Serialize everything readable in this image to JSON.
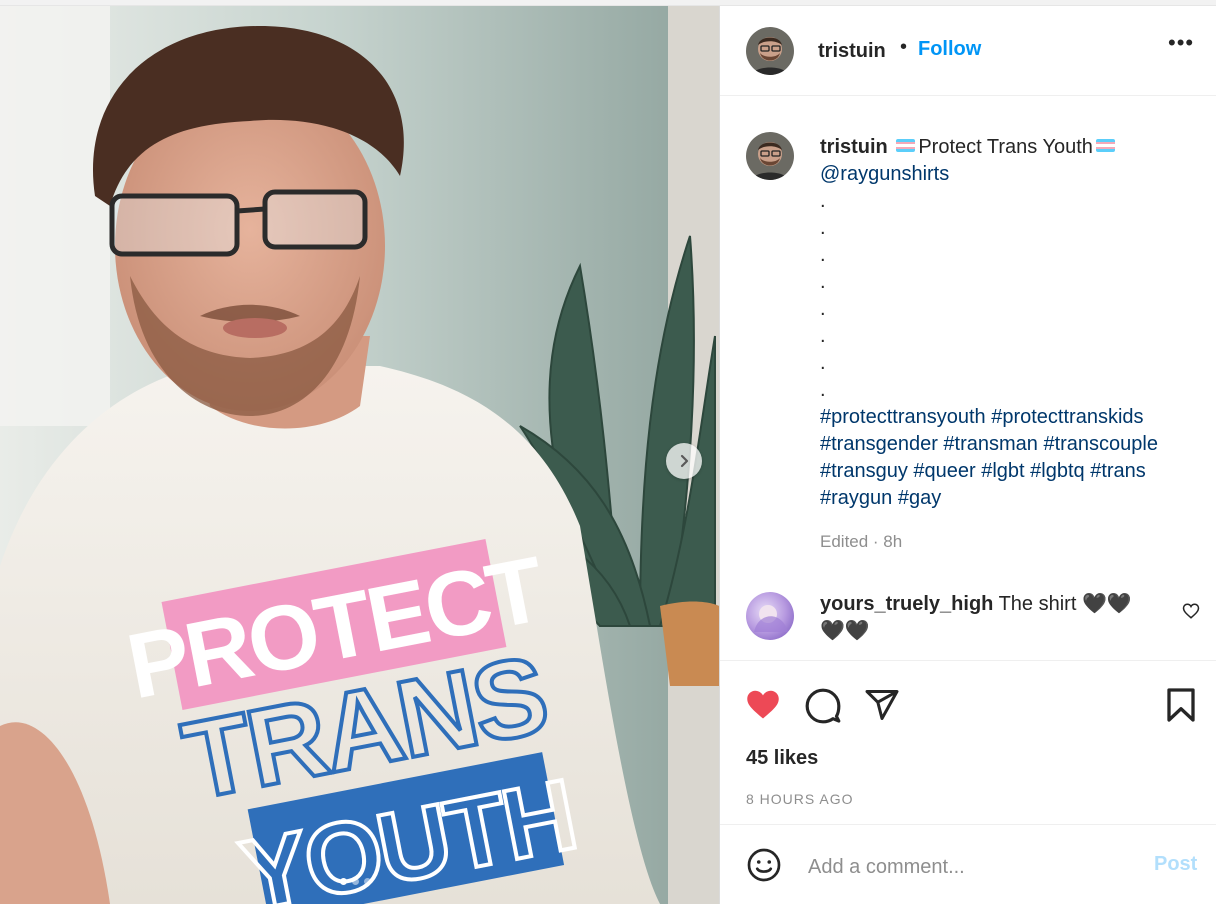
{
  "post": {
    "username": "tristuin",
    "follow_label": "Follow",
    "separator": "•",
    "more_label": "•••",
    "image_shirt_text": [
      "PROTECT",
      "TRANS",
      "YOUTH"
    ],
    "carousel_dots": 3,
    "carousel_active_index": 0
  },
  "caption": {
    "username": "tristuin",
    "text": "Protect Trans Youth",
    "mention": "@raygunshirts",
    "dots": [
      ".",
      ".",
      ".",
      ".",
      ".",
      ".",
      ".",
      "."
    ],
    "hashtags": "#protecttransyouth #protecttranskids #transgender #transman #transcouple #transguy #queer #lgbt #lgbtq #trans #raygun #gay",
    "edited": "Edited · 8h",
    "flag_colors": [
      "#5bcefa",
      "#f5a9b8",
      "#ffffff",
      "#f5a9b8",
      "#5bcefa"
    ]
  },
  "comment": {
    "username": "yours_truely_high",
    "text": "The shirt 🖤🖤 🖤🖤"
  },
  "actions": {
    "likes": "45 likes",
    "time": "8 HOURS AGO",
    "liked": true,
    "like_color": "#ed4956"
  },
  "comment_box": {
    "placeholder": "Add a comment...",
    "post_label": "Post"
  },
  "colors": {
    "accent": "#0095f6",
    "link": "#00376b",
    "muted": "#8e8e8e"
  }
}
